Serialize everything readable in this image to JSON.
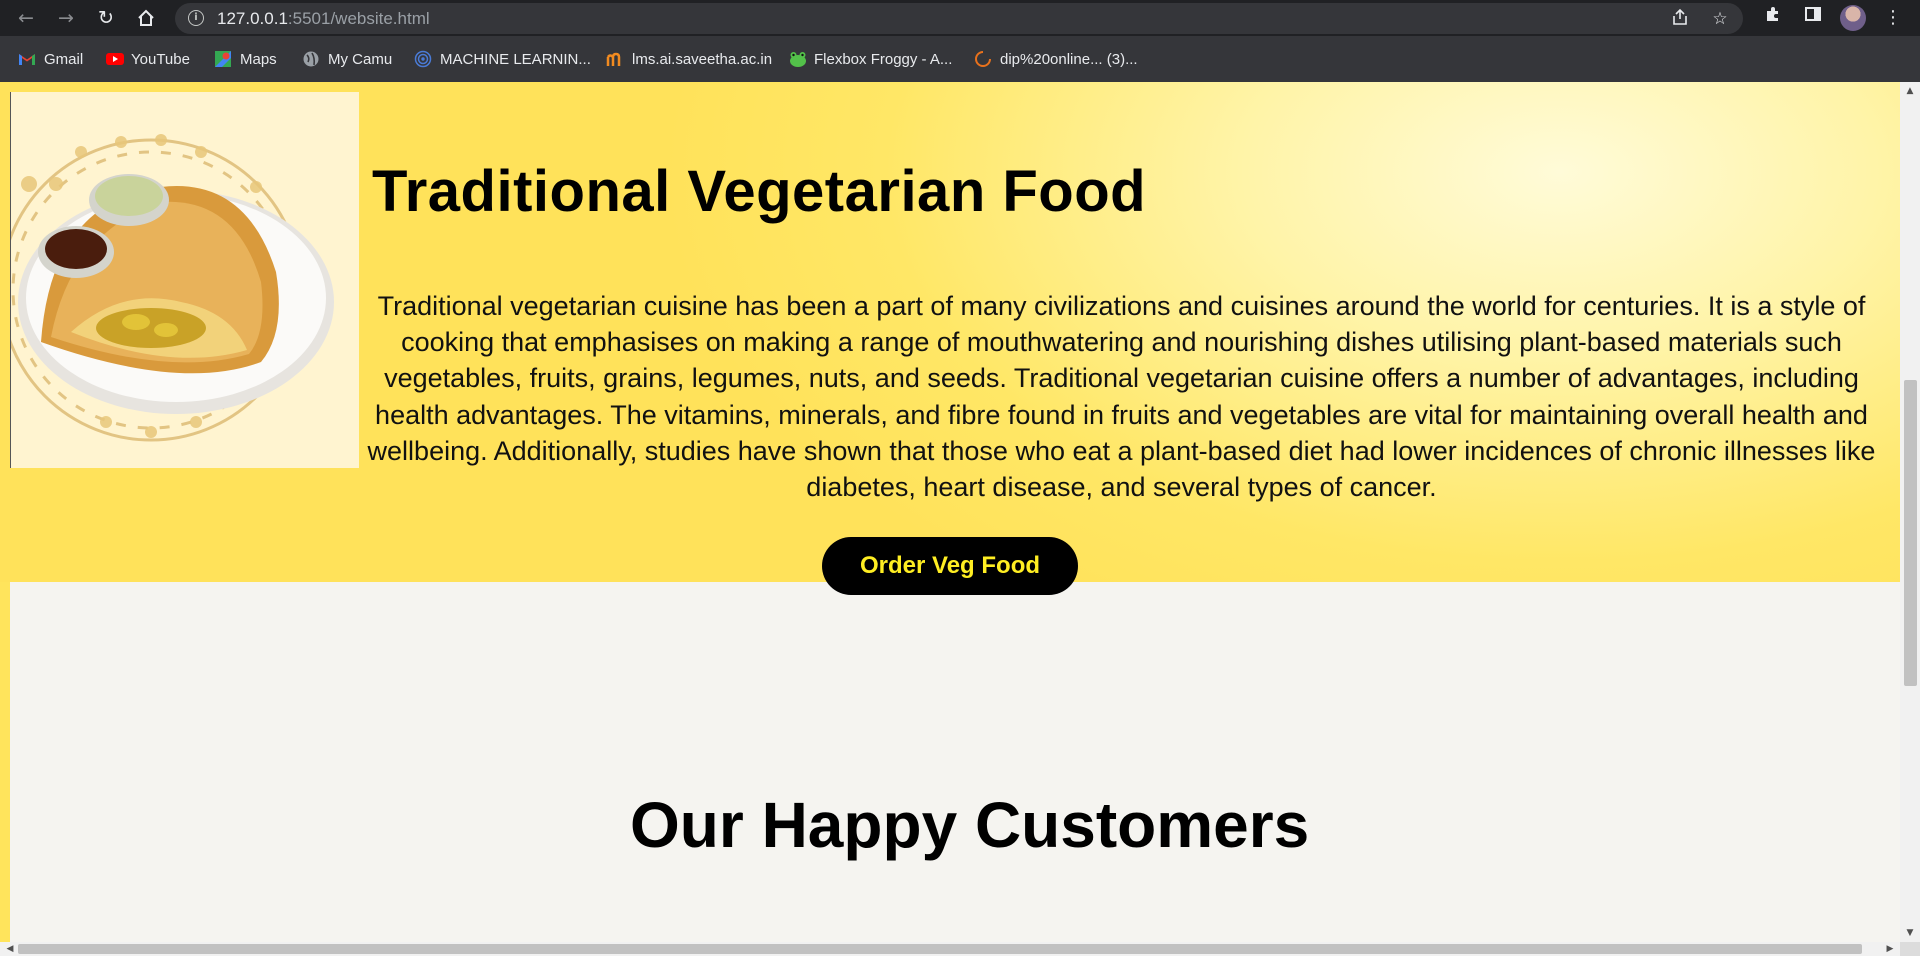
{
  "browser": {
    "url_host": "127.0.0.1",
    "url_rest": ":5501/website.html",
    "bookmarks": [
      {
        "label": "Gmail",
        "icon": "gmail-icon"
      },
      {
        "label": "YouTube",
        "icon": "youtube-icon"
      },
      {
        "label": "Maps",
        "icon": "maps-icon"
      },
      {
        "label": "My Camu",
        "icon": "globe-icon"
      },
      {
        "label": "MACHINE LEARNIN...",
        "icon": "spiral-icon"
      },
      {
        "label": "lms.ai.saveetha.ac.in",
        "icon": "lms-icon"
      },
      {
        "label": "Flexbox Froggy - A...",
        "icon": "frog-icon"
      },
      {
        "label": "dip%20online... (3)...",
        "icon": "loading-icon"
      }
    ]
  },
  "hero": {
    "title": "Traditional Vegetarian Food",
    "description": "Traditional vegetarian cuisine has been a part of many civilizations and cuisines around the world for centuries. It is a style of cooking that emphasises on making a range of mouthwatering and nourishing dishes utilising plant-based materials such vegetables, fruits, grains, legumes, nuts, and seeds. Traditional vegetarian cuisine offers a number of advantages, including health advantages. The vitamins, minerals, and fibre found in fruits and vegetables are vital for maintaining overall health and wellbeing. Additionally, studies have shown that those who eat a plant-based diet had lower incidences of chronic illnesses like diabetes, heart disease, and several types of cancer.",
    "button_label": "Order Veg Food",
    "image_alt": "dosa-with-chutney"
  },
  "customers": {
    "title": "Our Happy Customers"
  },
  "colors": {
    "hero_yellow": "#ffe25a",
    "button_bg": "#000000",
    "button_text": "#ffee22",
    "page_bg": "#f5f4f0"
  }
}
